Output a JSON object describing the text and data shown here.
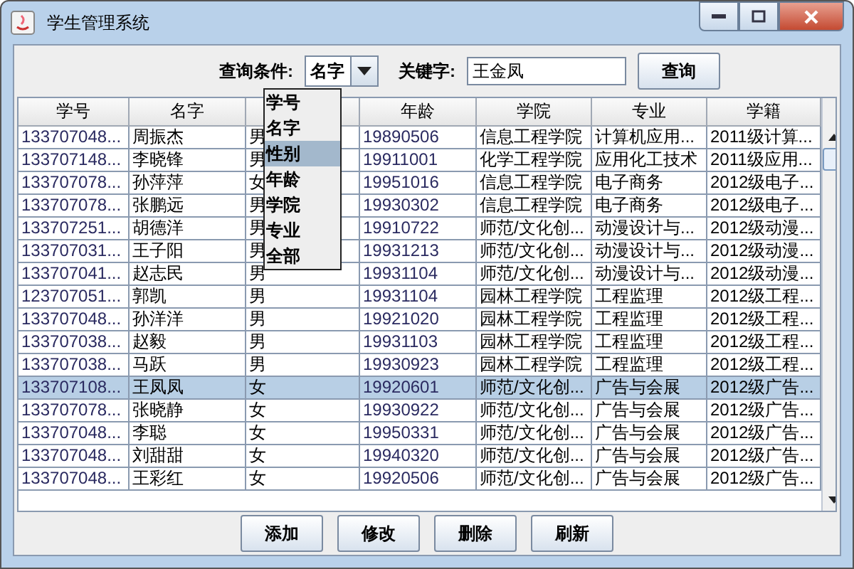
{
  "window": {
    "title": "学生管理系统"
  },
  "search": {
    "condition_label": "查询条件:",
    "condition_value": "名字",
    "keyword_label": "关键字:",
    "keyword_value": "王金凤",
    "button": "查询"
  },
  "dropdown": {
    "options": [
      {
        "label": "学号",
        "selected": false
      },
      {
        "label": "名字",
        "selected": false
      },
      {
        "label": "性别",
        "selected": true
      },
      {
        "label": "年龄",
        "selected": false
      },
      {
        "label": "学院",
        "selected": false
      },
      {
        "label": "专业",
        "selected": false
      },
      {
        "label": "全部",
        "selected": false
      }
    ]
  },
  "table": {
    "columns": [
      "学号",
      "名字",
      "",
      "年龄",
      "学院",
      "专业",
      "学籍"
    ],
    "rows": [
      {
        "cells": [
          "133707048...",
          "周振杰",
          "男",
          "19890506",
          "信息工程学院",
          "计算机应用...",
          "2011级计算..."
        ],
        "selected": false
      },
      {
        "cells": [
          "133707148...",
          "李晓锋",
          "男",
          "19911001",
          "化学工程学院",
          "应用化工技术",
          "2011级应用..."
        ],
        "selected": false
      },
      {
        "cells": [
          "133707078...",
          "孙萍萍",
          "女",
          "19951016",
          "信息工程学院",
          "电子商务",
          "2012级电子..."
        ],
        "selected": false
      },
      {
        "cells": [
          "133707078...",
          "张鹏远",
          "男",
          "19930302",
          "信息工程学院",
          "电子商务",
          "2012级电子..."
        ],
        "selected": false
      },
      {
        "cells": [
          "133707251...",
          "胡德洋",
          "男",
          "19910722",
          "师范/文化创...",
          "动漫设计与...",
          "2012级动漫..."
        ],
        "selected": false
      },
      {
        "cells": [
          "133707031...",
          "王子阳",
          "男",
          "19931213",
          "师范/文化创...",
          "动漫设计与...",
          "2012级动漫..."
        ],
        "selected": false
      },
      {
        "cells": [
          "133707041...",
          "赵志民",
          "男",
          "19931104",
          "师范/文化创...",
          "动漫设计与...",
          "2012级动漫..."
        ],
        "selected": false
      },
      {
        "cells": [
          "123707051...",
          "郭凯",
          "男",
          "19931104",
          "园林工程学院",
          "工程监理",
          "2012级工程..."
        ],
        "selected": false
      },
      {
        "cells": [
          "133707048...",
          "孙洋洋",
          "男",
          "19921020",
          "园林工程学院",
          "工程监理",
          "2012级工程..."
        ],
        "selected": false
      },
      {
        "cells": [
          "133707038...",
          "赵毅",
          "男",
          "19931103",
          "园林工程学院",
          "工程监理",
          "2012级工程..."
        ],
        "selected": false
      },
      {
        "cells": [
          "133707038...",
          "马跃",
          "男",
          "19930923",
          "园林工程学院",
          "工程监理",
          "2012级工程..."
        ],
        "selected": false
      },
      {
        "cells": [
          "133707108...",
          "王凤凤",
          "女",
          "19920601",
          "师范/文化创...",
          "广告与会展",
          "2012级广告..."
        ],
        "selected": true
      },
      {
        "cells": [
          "133707078...",
          "张晓静",
          "女",
          "19930922",
          "师范/文化创...",
          "广告与会展",
          "2012级广告..."
        ],
        "selected": false
      },
      {
        "cells": [
          "133707048...",
          "李聪",
          "女",
          "19950331",
          "师范/文化创...",
          "广告与会展",
          "2012级广告..."
        ],
        "selected": false
      },
      {
        "cells": [
          "133707048...",
          "刘甜甜",
          "女",
          "19940320",
          "师范/文化创...",
          "广告与会展",
          "2012级广告..."
        ],
        "selected": false
      },
      {
        "cells": [
          "133707048...",
          "王彩红",
          "女",
          "19920506",
          "师范/文化创...",
          "广告与会展",
          "2012级广告..."
        ],
        "selected": false
      }
    ]
  },
  "buttons": [
    "添加",
    "修改",
    "删除",
    "刷新"
  ]
}
